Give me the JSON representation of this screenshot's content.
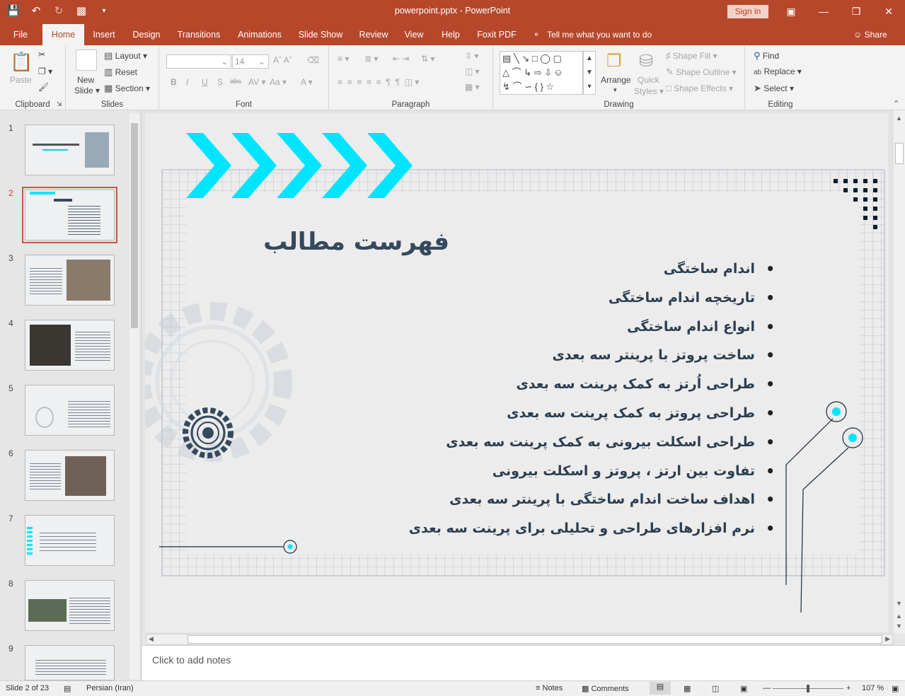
{
  "window": {
    "title": "powerpoint.pptx  -  PowerPoint",
    "signin": "Sign in",
    "qat": [
      "save-icon",
      "undo-icon",
      "redo-icon",
      "present-icon",
      "customize-icon"
    ]
  },
  "tabs": [
    {
      "label": "File",
      "active": false
    },
    {
      "label": "Home",
      "active": true
    },
    {
      "label": "Insert",
      "active": false
    },
    {
      "label": "Design",
      "active": false
    },
    {
      "label": "Transitions",
      "active": false
    },
    {
      "label": "Animations",
      "active": false
    },
    {
      "label": "Slide Show",
      "active": false
    },
    {
      "label": "Review",
      "active": false
    },
    {
      "label": "View",
      "active": false
    },
    {
      "label": "Help",
      "active": false
    },
    {
      "label": "Foxit PDF",
      "active": false
    }
  ],
  "tellme": "Tell me what you want to do",
  "share": "Share",
  "ribbon": {
    "clipboard": {
      "label": "Clipboard",
      "paste": "Paste"
    },
    "slides": {
      "label": "Slides",
      "new_slide": "New",
      "new_slide2": "Slide",
      "layout": "Layout",
      "reset": "Reset",
      "section": "Section"
    },
    "font": {
      "label": "Font",
      "size": "14"
    },
    "paragraph": {
      "label": "Paragraph"
    },
    "drawing": {
      "label": "Drawing",
      "arrange": "Arrange",
      "quick": "Quick",
      "styles": "Styles",
      "fill": "Shape Fill",
      "outline": "Shape Outline",
      "effects": "Shape Effects"
    },
    "editing": {
      "label": "Editing",
      "find": "Find",
      "replace": "Replace",
      "select": "Select"
    }
  },
  "thumbnails": [
    "1",
    "2",
    "3",
    "4",
    "5",
    "6",
    "7",
    "8",
    "9"
  ],
  "selected_slide": 2,
  "slide": {
    "title": "فهرست مطالب",
    "bullets": [
      "اندام ساختگی",
      "تاریخچه اندام ساختگی",
      "انواع اندام ساختگی",
      "ساخت پروتز با پرینتر سه بعدی",
      "طراحی اُرتز به کمک پرینت سه بعدی",
      "طراحی پروتز به کمک پرینت سه بعدی",
      "طراحی اسکلت بیرونی به کمک پرینت سه بعدی",
      "تفاوت بین ارتز ، پروتز و اسکلت بیرونی",
      "اهداف ساخت اندام ساختگی با پرینتر سه بعدی",
      "نرم افزارهای طراحی و تحلیلی برای پرینت سه بعدی"
    ],
    "accent_color": "#00e5ff",
    "text_color": "#34495e"
  },
  "notes_placeholder": "Click to add notes",
  "status": {
    "slide_info": "Slide 2 of 23",
    "language": "Persian (Iran)",
    "notes": "Notes",
    "comments": "Comments",
    "zoom": "107 %"
  }
}
